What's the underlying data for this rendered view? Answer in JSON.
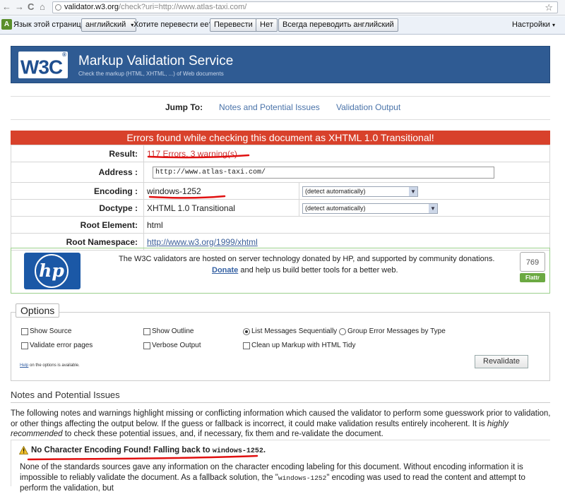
{
  "browser": {
    "url_host": "validator.w3.org",
    "url_path": "/check?uri=http://www.atlas-taxi.com/"
  },
  "translate_bar": {
    "language_label": "Язык этой страницы",
    "language_value": "английский",
    "question": "Хотите перевести ее?",
    "translate_btn": "Перевести",
    "no_btn": "Нет",
    "always_btn": "Всегда переводить английский",
    "settings": "Настройки"
  },
  "header": {
    "logo": "W3C",
    "logo_mark": "®",
    "title": "Markup Validation Service",
    "subtitle": "Check the markup (HTML, XHTML, ...) of Web documents"
  },
  "jump": {
    "label": "Jump To:",
    "links": [
      "Notes and Potential Issues",
      "Validation Output"
    ]
  },
  "result": {
    "banner": "Errors found while checking this document as XHTML 1.0 Transitional!",
    "rows": {
      "result_label": "Result:",
      "result_value": "117 Errors, 3 warning(s)",
      "address_label": "Address :",
      "address_value": "http://www.atlas-taxi.com/",
      "encoding_label": "Encoding :",
      "encoding_value": "windows-1252",
      "encoding_select": "(detect automatically)",
      "doctype_label": "Doctype :",
      "doctype_value": "XHTML 1.0 Transitional",
      "doctype_select": "(detect automatically)",
      "root_label": "Root Element:",
      "root_value": "html",
      "ns_label": "Root Namespace:",
      "ns_value": "http://www.w3.org/1999/xhtml"
    }
  },
  "donation": {
    "hp_logo": "hp",
    "text1": "The W3C validators are hosted on server technology donated by HP, and supported by community donations.",
    "donate_link": "Donate",
    "text2": " and help us build better tools for a better web.",
    "flattr_count": "769",
    "flattr_label": "Flattr"
  },
  "options": {
    "legend": "Options",
    "show_source": "Show Source",
    "show_outline": "Show Outline",
    "list_seq": "List Messages Sequentially",
    "group_err": "Group Error Messages by Type",
    "validate_err": "Validate error pages",
    "verbose": "Verbose Output",
    "cleanup": "Clean up Markup with HTML Tidy",
    "help_link": "Help",
    "help_text": " on the options is available.",
    "revalidate": "Revalidate"
  },
  "notes": {
    "title": "Notes and Potential Issues",
    "para_a": "The following notes and warnings highlight missing or conflicting information which caused the validator to perform some guesswork prior to validation, or other things affecting the output below. If the guess or fallback is incorrect, it could make validation results entirely incoherent. It is ",
    "para_em": "highly recommended",
    "para_b": " to check these potential issues, and, if necessary, fix them and re-validate the document.",
    "warn_title": "No Character Encoding Found! Falling back to ",
    "warn_code": "windows-1252",
    "warn_title_end": ".",
    "warn_a": "None of the standards sources gave any information on the character encoding labeling for this document. Without encoding information it is impossible to reliably validate the document. As a fallback solution, the \"",
    "warn_code2": "windows-1252",
    "warn_b": "\" encoding was used to read the content and attempt to perform the validation, but"
  }
}
